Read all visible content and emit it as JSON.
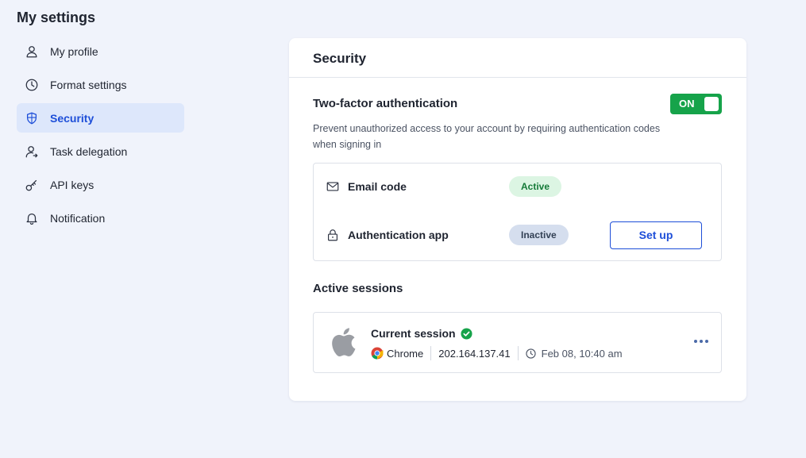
{
  "page": {
    "title": "My settings"
  },
  "sidebar": {
    "items": [
      {
        "label": "My profile",
        "icon": "user-icon",
        "active": false
      },
      {
        "label": "Format settings",
        "icon": "clock-icon",
        "active": false
      },
      {
        "label": "Security",
        "icon": "shield-icon",
        "active": true
      },
      {
        "label": "Task delegation",
        "icon": "user-arrow-icon",
        "active": false
      },
      {
        "label": "API keys",
        "icon": "key-icon",
        "active": false
      },
      {
        "label": "Notification",
        "icon": "bell-icon",
        "active": false
      }
    ]
  },
  "security": {
    "title": "Security",
    "two_factor": {
      "title": "Two-factor authentication",
      "toggle_label": "ON",
      "description": "Prevent unauthorized access to your account by requiring authentication codes when signing in",
      "methods": [
        {
          "label": "Email code",
          "icon": "mail-icon",
          "status": "Active"
        },
        {
          "label": "Authentication app",
          "icon": "lock-icon",
          "status": "Inactive",
          "action": "Set up"
        }
      ]
    },
    "sessions": {
      "title": "Active sessions",
      "current": {
        "title": "Current session",
        "browser": "Chrome",
        "ip": "202.164.137.41",
        "time": "Feb 08, 10:40 am"
      }
    }
  },
  "colors": {
    "accent": "#1d4ed8",
    "toggle_on": "#16a34a",
    "active_badge_bg": "#dcf5e3",
    "inactive_badge_bg": "#d5deee",
    "background": "#f0f3fb"
  }
}
